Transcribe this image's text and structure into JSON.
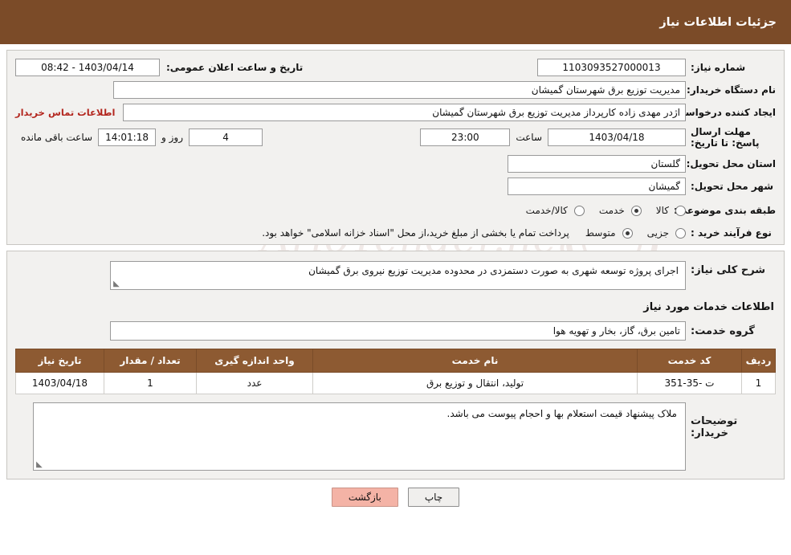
{
  "header": {
    "title": "جزئیات اطلاعات نیاز"
  },
  "watermark": {
    "text": "ArioTender.net"
  },
  "top": {
    "need_number_label": "شماره نیاز:",
    "need_number_value": "1103093527000013",
    "announce_date_label": "تاریخ و ساعت اعلان عمومی:",
    "announce_date_value": "1403/04/14 - 08:42",
    "buyer_org_label": "نام دستگاه خریدار:",
    "buyer_org_value": "مدیریت توزیع برق شهرستان گمیشان",
    "requester_label": "ایجاد کننده درخواست:",
    "requester_value": "اژدر مهدی زاده کارپرداز مدیریت توزیع برق شهرستان گمیشان",
    "contact_link": "اطلاعات تماس خریدار",
    "deadline_label": "مهلت ارسال پاسخ: تا تاریخ:",
    "deadline_date": "1403/04/18",
    "hour_label": "ساعت",
    "deadline_time": "23:00",
    "days_value": "4",
    "days_word": "روز و",
    "countdown_value": "14:01:18",
    "remaining_word": "ساعت باقی مانده",
    "province_label": "استان محل تحویل:",
    "province_value": "گلستان",
    "city_label": "شهر محل تحویل:",
    "city_value": "گمیشان",
    "category_label": "طبقه بندی موضوعی:",
    "category_options": [
      {
        "label": "کالا",
        "checked": false
      },
      {
        "label": "خدمت",
        "checked": true
      },
      {
        "label": "کالا/خدمت",
        "checked": false
      }
    ],
    "process_label": "نوع فرآیند خرید :",
    "process_options": [
      {
        "label": "جزیی",
        "checked": false
      },
      {
        "label": "متوسط",
        "checked": true
      }
    ],
    "process_note": "پرداخت تمام یا بخشی از مبلغ خرید،از محل \"اسناد خزانه اسلامی\" خواهد بود."
  },
  "mid": {
    "summary_label": "شرح کلی نیاز:",
    "summary_value": "اجرای پروژه توسعه شهری به صورت دستمزدی در محدوده مدیریت توزیع نیروی برق گمیشان",
    "services_section_title": "اطلاعات خدمات مورد نیاز",
    "service_group_label": "گروه خدمت:",
    "service_group_value": "تامین برق، گاز، بخار و تهویه هوا",
    "table": {
      "headers": [
        "ردیف",
        "کد خدمت",
        "نام خدمت",
        "واحد اندازه گیری",
        "تعداد / مقدار",
        "تاریخ نیاز"
      ],
      "rows": [
        [
          "1",
          "ت -35-351",
          "تولید، انتقال و توزیع برق",
          "عدد",
          "1",
          "1403/04/18"
        ]
      ]
    },
    "buyer_notes_label": "توضیحات خریدار:",
    "buyer_notes_value": "ملاک پیشنهاد قیمت استعلام بها و احجام پیوست می باشد."
  },
  "buttons": {
    "print": "چاپ",
    "back": "بازگشت"
  }
}
